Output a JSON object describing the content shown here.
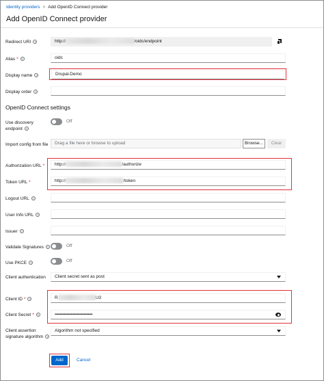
{
  "breadcrumb": {
    "parent": "Identity providers",
    "separator": ">",
    "current": "Add OpenID Connect provider"
  },
  "page": {
    "title": "Add OpenID Connect provider"
  },
  "fields": {
    "redirect_uri": {
      "label": "Redirect URI",
      "prefix": "http://",
      "suffix": "/oidc/endpoint"
    },
    "alias": {
      "label": "Alias",
      "value": "oidc"
    },
    "display_name": {
      "label": "Display name",
      "value": "Drupal-Demo"
    },
    "display_order": {
      "label": "Display order",
      "value": ""
    }
  },
  "settings": {
    "title": "OpenID Connect settings",
    "use_discovery": {
      "label_line1": "Use discovery",
      "label_line2": "endpoint",
      "state": "Off"
    },
    "import_config": {
      "label": "Import config from file",
      "placeholder": "Drag a file here or browse to upload",
      "browse": "Browse...",
      "clear": "Clear"
    },
    "authorization_url": {
      "label": "Authorization URL",
      "prefix": "http://",
      "suffix": "/authorize"
    },
    "token_url": {
      "label": "Token URL",
      "prefix": "http://",
      "suffix": "/token"
    },
    "logout_url": {
      "label": "Logout URL",
      "value": ""
    },
    "user_info_url": {
      "label": "User Info URL",
      "value": ""
    },
    "issuer": {
      "label": "Issuer",
      "value": ""
    },
    "validate_signatures": {
      "label": "Validate Signatures",
      "state": "Off"
    },
    "use_pkce": {
      "label": "Use PKCE",
      "state": "Off"
    },
    "client_authentication": {
      "label": "Client authentication",
      "value": "Client secret sent as post"
    },
    "client_id": {
      "label": "Client ID",
      "prefix": "R",
      "suffix": "U3"
    },
    "client_secret": {
      "label": "Client Secret",
      "value": "••••••••••••••••••••••••••••••••••••••••••••"
    },
    "client_assertion": {
      "label_line1": "Client assertion",
      "label_line2": "signature algorithm",
      "value": "Algorithm not specified"
    }
  },
  "actions": {
    "add": "Add",
    "cancel": "Cancel"
  },
  "icons": {
    "copy": "copy-icon",
    "help": "help-icon",
    "eye": "eye-icon",
    "caret": "caret-down-icon"
  },
  "colors": {
    "link": "#0066cc",
    "highlight": "#e0303a",
    "primary": "#0066cc"
  }
}
